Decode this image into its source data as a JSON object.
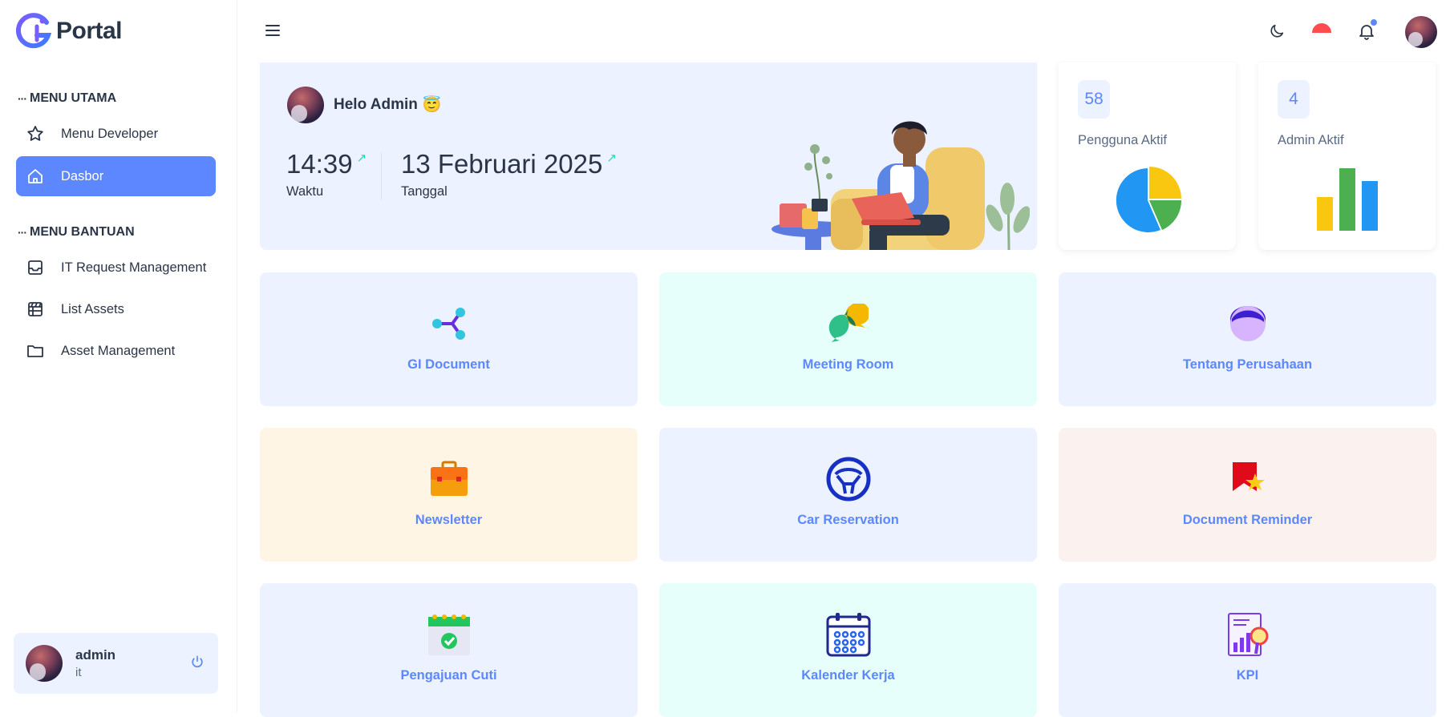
{
  "brand": {
    "name": "Portal",
    "accent": "#5d87ff"
  },
  "sidebar": {
    "sections": [
      {
        "title": "MENU UTAMA"
      },
      {
        "title": "MENU BANTUAN"
      }
    ],
    "items": [
      {
        "label": "Menu Developer",
        "icon": "star-icon"
      },
      {
        "label": "Dasbor",
        "icon": "home-icon",
        "active": true
      },
      {
        "label": "IT Request Management",
        "icon": "inbox-icon"
      },
      {
        "label": "List Assets",
        "icon": "clapperboard-icon"
      },
      {
        "label": "Asset Management",
        "icon": "folder-icon"
      }
    ],
    "user": {
      "name": "admin",
      "role": "it"
    }
  },
  "topbar": {
    "icons": [
      "menu-icon",
      "moon-icon",
      "flag-icon",
      "bell-icon",
      "avatar"
    ]
  },
  "welcome": {
    "greeting": "Helo Admin",
    "emoji": "😇",
    "time_value": "14:39",
    "time_label": "Waktu",
    "date_value": "13 Februari 2025",
    "date_label": "Tanggal"
  },
  "metrics": [
    {
      "value": "58",
      "label": "Pengguna Aktif",
      "viz": "pie-chart-icon"
    },
    {
      "value": "4",
      "label": "Admin Aktif",
      "viz": "bar-chart-icon"
    }
  ],
  "tiles": [
    {
      "label": "GI Document",
      "icon": "share-nodes-icon"
    },
    {
      "label": "Meeting Room",
      "icon": "chat-bubbles-icon"
    },
    {
      "label": "Tentang Perusahaan",
      "icon": "person-icon"
    },
    {
      "label": "Newsletter",
      "icon": "briefcase-icon"
    },
    {
      "label": "Car Reservation",
      "icon": "steering-wheel-icon"
    },
    {
      "label": "Document Reminder",
      "icon": "flag-star-icon"
    },
    {
      "label": "Pengajuan Cuti",
      "icon": "calendar-check-icon"
    },
    {
      "label": "Kalender Kerja",
      "icon": "calendar-icon"
    },
    {
      "label": "KPI",
      "icon": "kpi-report-icon"
    }
  ]
}
